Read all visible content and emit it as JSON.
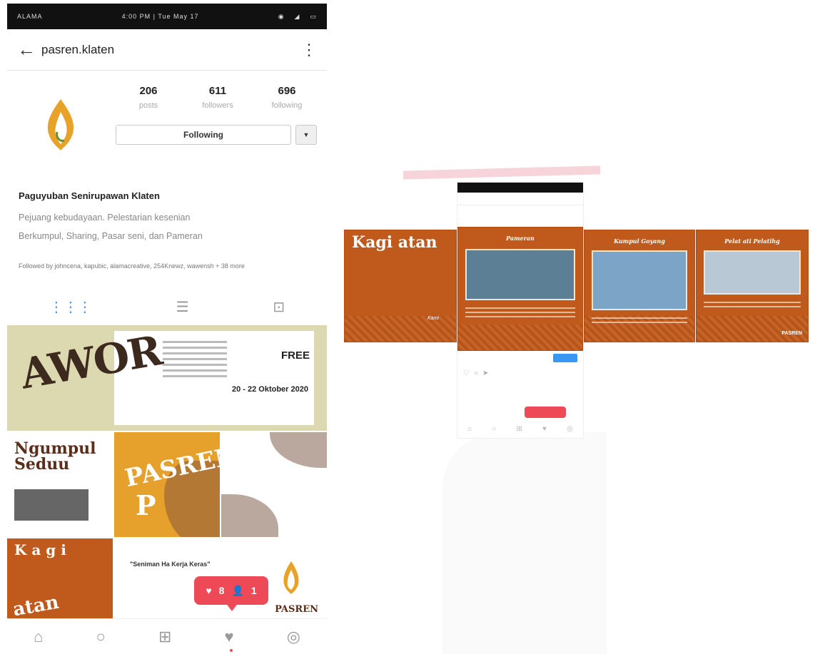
{
  "status_bar": {
    "carrier": "ALAMA",
    "time": "4:00 PM | Tue May 17"
  },
  "header": {
    "back_glyph": "←",
    "username": "pasren.klaten",
    "menu_glyph": "⋮"
  },
  "stats": [
    {
      "value": "206",
      "label": "posts"
    },
    {
      "value": "611",
      "label": "followers"
    },
    {
      "value": "696",
      "label": "following"
    }
  ],
  "follow": {
    "label": "Following",
    "dropdown_glyph": "▼"
  },
  "bio": {
    "name": "Paguyuban Senirupawan Klaten",
    "line1": "Pejuang kebudayaan. Pelestarian kesenian",
    "line2": "Berkumpul, Sharing, Pasar seni, dan Pameran",
    "followed_by": "Followed by johncena, kapubic, alamacreative, 254Knewz, wawensh + 38 more"
  },
  "tabs": {
    "grid_icon": "grid-icon",
    "list_icon": "list-icon",
    "tagged_icon": "tagged-icon"
  },
  "posts": {
    "banner": {
      "title": "AWOR",
      "free": "FREE",
      "date": "20 - 22 Oktober 2020"
    },
    "ngumpul": {
      "title": "Ngumpul Seduu"
    },
    "pasren": {
      "line1": "PASREN,",
      "line2": "P"
    },
    "kegiatan": {
      "line1": "K a g i",
      "line2": "atan"
    },
    "quote": {
      "text": "\"Seniman Ha Kerja Keras\"",
      "brand": "PASREN"
    }
  },
  "notification": {
    "likes": "8",
    "follows": "1"
  },
  "bottom_nav": {
    "home": "home-icon",
    "search": "search-icon",
    "add": "add-icon",
    "activity": "heart-icon",
    "profile": "profile-icon"
  },
  "mockup": {
    "title_pameran": "Pameran",
    "title_kumpul": "Kumpul Goyang",
    "title_pelatihan": "Pelat ati Pelatihg",
    "kegiatan": "Kagi atan",
    "kami": "Kami",
    "brand": "PASREN"
  },
  "colors": {
    "brand_orange": "#c0591c",
    "ig_red": "#ed4956",
    "ig_blue": "#3897f0"
  }
}
